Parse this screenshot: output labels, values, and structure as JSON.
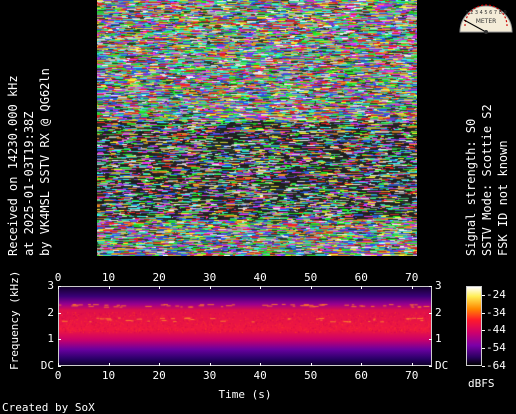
{
  "left_caption": {
    "line1": "Received on  14230.000 kHz",
    "line2": "at 2025-01-03T19:38Z",
    "line3": "by VK4MSL SSTV RX @ QG62ln"
  },
  "right_caption": {
    "line1": "Signal strength: S0",
    "line2": "SSTV Mode: Scottie S2",
    "line3": "FSK ID not known"
  },
  "meter": {
    "label": "METER",
    "scale": "1 2 3 4 5 6 7 8 9",
    "needle_level": 0
  },
  "spectrogram": {
    "xlabel": "Time (s)",
    "ylabel": "Frequency (kHz)",
    "x_ticks": [
      "0",
      "10",
      "20",
      "30",
      "40",
      "50",
      "60",
      "70"
    ],
    "x_values": [
      0,
      10,
      20,
      30,
      40,
      50,
      60,
      70
    ],
    "x_range": [
      0,
      74
    ],
    "y_ticks": [
      "3",
      "2",
      "1",
      "DC"
    ],
    "y_values": [
      3,
      2,
      1,
      0
    ],
    "y_range": [
      0,
      3
    ],
    "colorbar_label": "dBFS",
    "colorbar_ticks": [
      "-24",
      "-34",
      "-44",
      "-54",
      "-64"
    ],
    "colorbar_values": [
      -24,
      -34,
      -44,
      -54,
      -64
    ],
    "colorbar_range": [
      -64,
      -19
    ]
  },
  "footer": {
    "credit": "Created by SoX"
  }
}
